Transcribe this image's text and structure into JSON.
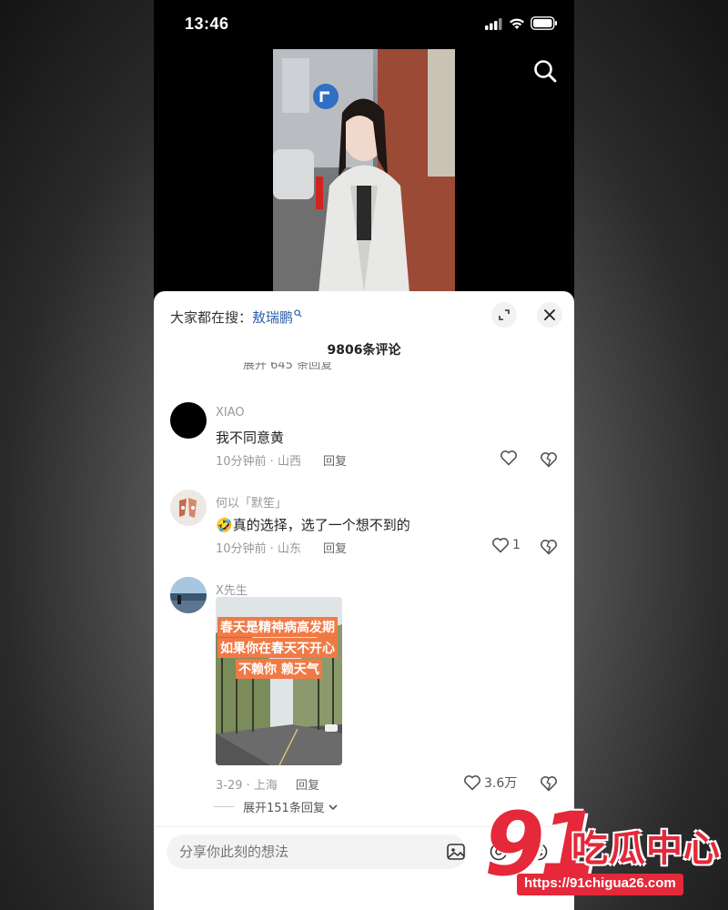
{
  "status_bar": {
    "time": "13:46"
  },
  "hot_search": {
    "prefix": "大家都在搜：",
    "keyword": "敖瑞鹏"
  },
  "comments_header": {
    "count_label": "9806条评论",
    "cut_text": "展开 645 条回复"
  },
  "comments": [
    {
      "name": "XIAO",
      "text": "我不同意黄",
      "meta": "10分钟前 · 山西",
      "reply_label": "回复",
      "likes": ""
    },
    {
      "name": "何以「默笙」",
      "text": "真的选择，选了一个想不到的",
      "emoji": "🤣",
      "meta": "10分钟前 · 山东",
      "reply_label": "回复",
      "likes": "1"
    },
    {
      "name": "X先生",
      "meta": "3-29 · 上海",
      "reply_label": "回复",
      "likes": "3.6万",
      "image_captions": [
        "春天是精神病高发期",
        "如果你在春天不开心",
        "不赖你 赖天气"
      ]
    }
  ],
  "expand_replies": {
    "label": "展开151条回复"
  },
  "input": {
    "placeholder": "分享你此刻的想法"
  },
  "watermark": {
    "number": "91",
    "title": "吃瓜中心",
    "url": "https://91chigua26.com"
  },
  "colors": {
    "accent_link": "#2c5fa8",
    "watermark_red": "#e5283a",
    "caption_orange": "#f07a46"
  }
}
